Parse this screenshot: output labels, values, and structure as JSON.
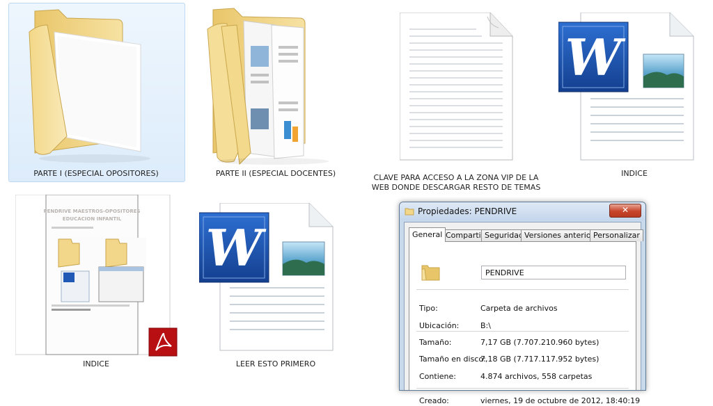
{
  "items": [
    {
      "label": "PARTE I (ESPECIAL OPOSITORES)",
      "icon": "folder-icon",
      "selected": true
    },
    {
      "label": "PARTE II (ESPECIAL DOCENTES)",
      "icon": "folder-icon"
    },
    {
      "label_line1": "CLAVE PARA ACCESO A LA ZONA VIP DE LA",
      "label_line2": "WEB DONDE DESCARGAR RESTO DE TEMAS",
      "icon": "text-file-icon"
    },
    {
      "label": "INDICE",
      "icon": "word-document-icon"
    },
    {
      "label": "INDICE",
      "icon": "pdf-document-icon",
      "thumb_title_line1": "PENDRIVE MAESTROS-OPOSITORES",
      "thumb_title_line2": "EDUCACION INFANTIL"
    },
    {
      "label": "LEER ESTO PRIMERO",
      "icon": "word-document-icon"
    }
  ],
  "properties_window": {
    "title": "Propiedades: PENDRIVE",
    "close_glyph": "✕",
    "tabs": [
      "General",
      "Compartir",
      "Seguridad",
      "Versiones anteriores",
      "Personalizar"
    ],
    "active_tab": "General",
    "name": "PENDRIVE",
    "rows": [
      {
        "label": "Tipo:",
        "value": "Carpeta de archivos"
      },
      {
        "label": "Ubicación:",
        "value": "B:\\"
      },
      {
        "label": "Tamaño:",
        "value": "7,17 GB (7.707.210.960 bytes)"
      },
      {
        "label": "Tamaño en disco:",
        "value": "7,18 GB (7.717.117.952 bytes)"
      },
      {
        "label": "Contiene:",
        "value": "4.874 archivos, 558 carpetas"
      },
      {
        "label": "Creado:",
        "value": "viernes, 19 de octubre de 2012, 18:40:19"
      }
    ]
  },
  "colors": {
    "folder": "#f2d68a",
    "word_blue": "#1f58b5",
    "pdf_red": "#c8102e",
    "selection": "#ddecfb"
  }
}
